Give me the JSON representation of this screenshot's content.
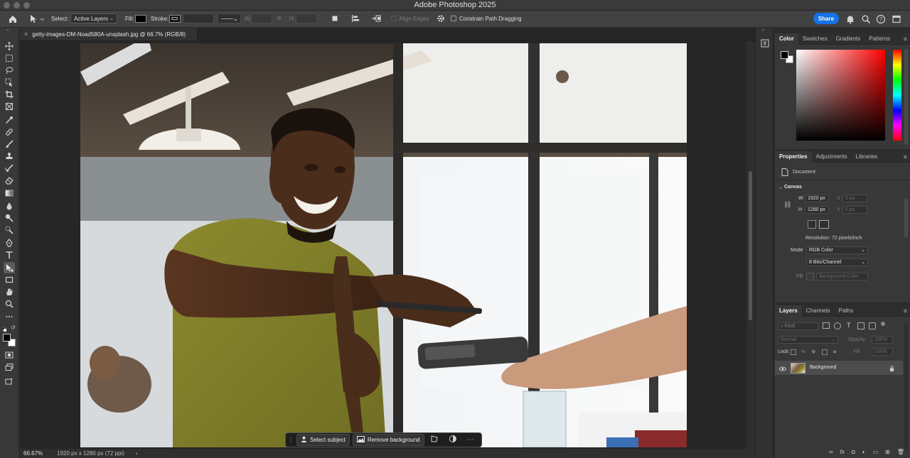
{
  "app": {
    "title": "Adobe Photoshop 2025"
  },
  "options_bar": {
    "select_label": "Select:",
    "select_value": "Active Layers",
    "fill_label": "Fill:",
    "stroke_label": "Stroke:",
    "w_label": "W:",
    "h_label": "H:",
    "align_edges": "Align Edges",
    "constrain": "Constrain Path Dragging",
    "share": "Share"
  },
  "document": {
    "tab_title": "getty-images-DM-Noad580A-unsplash.jpg @ 66.7% (RGB/8)"
  },
  "status": {
    "zoom": "66.67%",
    "info": "1920 px x 1280 px (72 ppi)"
  },
  "context_bar": {
    "select_subject": "Select subject",
    "remove_background": "Remove background"
  },
  "color_panel": {
    "tabs": [
      "Color",
      "Swatches",
      "Gradients",
      "Patterns"
    ]
  },
  "properties_panel": {
    "tabs": [
      "Properties",
      "Adjustments",
      "Libraries"
    ],
    "doc_label": "Document",
    "section": "Canvas",
    "w_label": "W",
    "w_value": "1920 px",
    "h_label": "H",
    "h_value": "1280 px",
    "x_label": "X",
    "x_placeholder": "0 px",
    "y_label": "Y",
    "y_placeholder": "0 px",
    "resolution": "Resolution: 72 pixels/inch",
    "mode_label": "Mode",
    "mode_value": "RGB Color",
    "bits_value": "8 Bits/Channel",
    "fill_label": "Fill",
    "fill_value": "Background Color"
  },
  "layers_panel": {
    "tabs": [
      "Layers",
      "Channels",
      "Paths"
    ],
    "kind": "Kind",
    "blend": "Normal",
    "opacity_label": "Opacity:",
    "opacity_value": "100%",
    "lock_label": "Lock:",
    "fill_label": "Fill:",
    "fill_value": "100%",
    "layers": [
      {
        "name": "Background"
      }
    ]
  },
  "colors": {
    "accent": "#1473e6",
    "panel": "#383838",
    "canvas_bg": "#262626"
  }
}
